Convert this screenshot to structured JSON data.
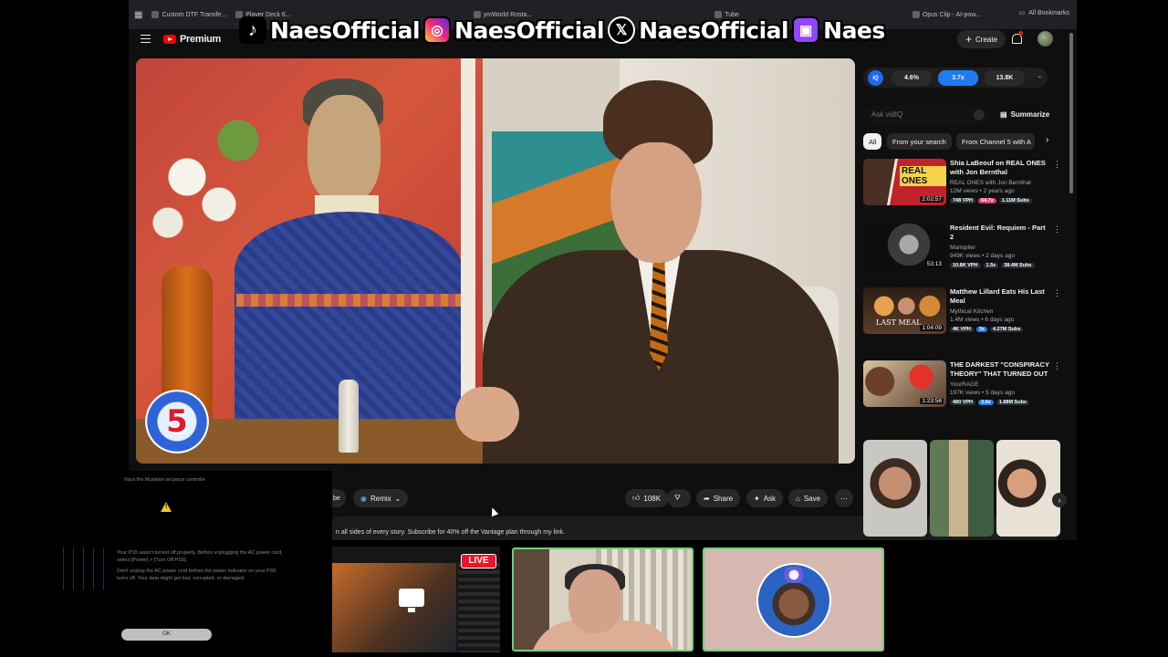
{
  "browser": {
    "bookmarks": [
      "Custom DTF Transfe...",
      "Player Deck 6...",
      "ymWorld Rosta...",
      "Tube",
      "Opus Clip - AI-pow..."
    ],
    "all_bookmarks": "All Bookmarks"
  },
  "youtube": {
    "logo_text": "Premium",
    "create_label": "Create"
  },
  "social_banner": {
    "tiktok": "NaesOfficial",
    "instagram": "NaesOfficial",
    "x": "NaesOfficial",
    "twitch": "Naes"
  },
  "video": {
    "channel_logo_text": "5"
  },
  "actions": {
    "remix": "Remix",
    "likes": "108K",
    "share": "Share",
    "ask": "Ask",
    "save": "Save",
    "subscribe_fragment": "be"
  },
  "description": "n all sides of every story. Subscribe for 40% off the Vantage plan through my link.",
  "sidebar": {
    "vidiq_logo": "iQ",
    "stats": [
      "4.6%",
      "3.7x",
      "13.8K"
    ],
    "ask_placeholder": "Ask vidIQ",
    "summarize": "Summarize",
    "chips": [
      "All",
      "From your search",
      "From Channel 5 with A"
    ],
    "recommendations": [
      {
        "title": "Shia LaBeouf on REAL ONES with Jon Bernthal",
        "channel": "REAL ONES with Jon Bernthal",
        "meta": "12M views • 2 years ago",
        "duration": "2:02:57",
        "tags": [
          "748 VPH",
          "64.7x",
          "1.11M Subs"
        ]
      },
      {
        "title": "Resident Evil: Requiem - Part 2",
        "channel": "Markiplier",
        "meta": "949K views • 2 days ago",
        "duration": "53:13",
        "tags": [
          "10.8K VPH",
          "1.5x",
          "38.4M Subs"
        ]
      },
      {
        "title": "Matthew Lillard Eats His Last Meal",
        "channel": "Mythical Kitchen",
        "meta": "1.4M views • 6 days ago",
        "duration": "1:04:09",
        "tags": [
          "4K VPH",
          "3x",
          "4.27M Subs"
        ]
      },
      {
        "title": "THE DARKEST \"CONSPIRACY THEORY\" THAT TURNED OUT ...",
        "channel": "YourRAGE",
        "meta": "197K views • 5 days ago",
        "duration": "1:23:58",
        "tags": [
          "480 VPH",
          "3.6x",
          "1.88M Subs"
        ]
      }
    ]
  },
  "warning": {
    "header": "Vous the Mutation ist parce controlle",
    "lines": [
      "Your PS5 wasn't turned off properly. Before unplugging the AC power cord, select [Power] > [Turn Off PS5].",
      "Don't unplug the AC power cord before the power indicator on your PS5 turns off. Your data might get lost, corrupted, or damaged."
    ],
    "ok": "OK"
  },
  "stream": {
    "live": "LIVE"
  }
}
